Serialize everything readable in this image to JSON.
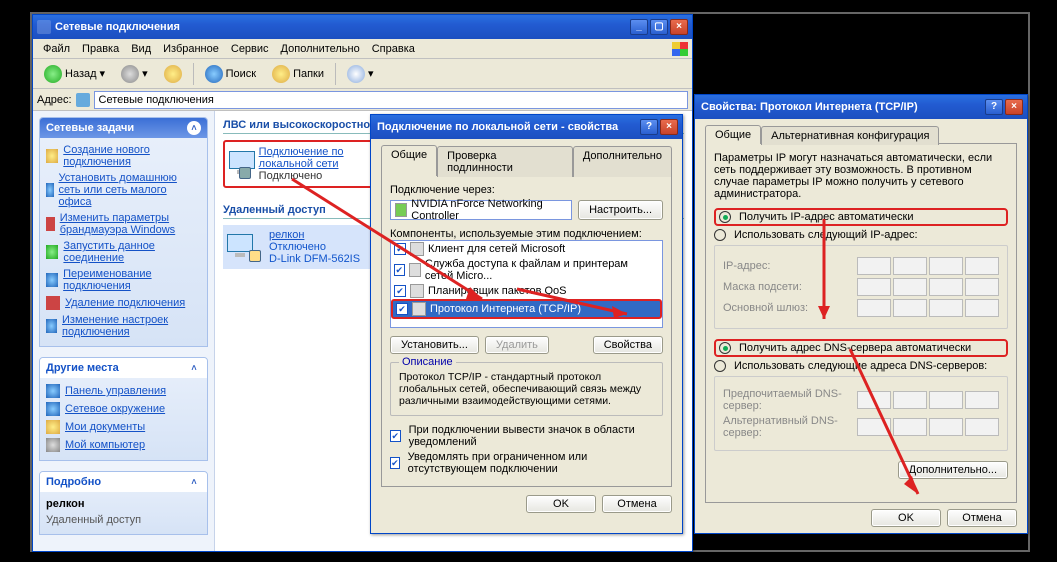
{
  "explorer": {
    "title": "Сетевые подключения",
    "menu": [
      "Файл",
      "Правка",
      "Вид",
      "Избранное",
      "Сервис",
      "Дополнительно",
      "Справка"
    ],
    "toolbar": {
      "back": "Назад",
      "search": "Поиск",
      "folders": "Папки"
    },
    "address_label": "Адрес:",
    "address_value": "Сетевые подключения",
    "pane_tasks": {
      "title": "Сетевые задачи",
      "items": [
        "Создание нового подключения",
        "Установить домашнюю сеть или сеть малого офиса",
        "Изменить параметры брандмауэра Windows",
        "Запустить данное соединение",
        "Переименование подключения",
        "Удаление подключения",
        "Изменение настроек подключения"
      ]
    },
    "pane_places": {
      "title": "Другие места",
      "items": [
        "Панель управления",
        "Сетевое окружение",
        "Мои документы",
        "Мой компьютер"
      ]
    },
    "pane_details": {
      "title": "Подробно",
      "name": "релкон",
      "type": "Удаленный доступ"
    },
    "groups": {
      "lan": "ЛВС или высокоскоростной Интернет",
      "dialup": "Удаленный доступ"
    },
    "lan_item": {
      "name": "Подключение по локальной сети",
      "status": "Подключено"
    },
    "dial_item": {
      "name": "релкон",
      "status": "Отключено",
      "device": "D-Link DFM-562IS"
    }
  },
  "props1": {
    "title": "Подключение по локальной сети - свойства",
    "tabs": [
      "Общие",
      "Проверка подлинности",
      "Дополнительно"
    ],
    "connect_via": "Подключение через:",
    "adapter": "NVIDIA nForce Networking Controller",
    "configure": "Настроить...",
    "components": "Компоненты, используемые этим подключением:",
    "list": [
      "Клиент для сетей Microsoft",
      "Служба доступа к файлам и принтерам сетей Micro...",
      "Планировщик пакетов QoS",
      "Протокол Интернета (TCP/IP)"
    ],
    "install": "Установить...",
    "remove": "Удалить",
    "properties": "Свойства",
    "desc_title": "Описание",
    "desc": "Протокол TCP/IP - стандартный протокол глобальных сетей, обеспечивающий связь между различными взаимодействующими сетями.",
    "tray": "При подключении вывести значок в области уведомлений",
    "notify": "Уведомлять при ограниченном или отсутствующем подключении",
    "ok": "OK",
    "cancel": "Отмена"
  },
  "props2": {
    "title": "Свойства: Протокол Интернета (TCP/IP)",
    "tabs": [
      "Общие",
      "Альтернативная конфигурация"
    ],
    "intro": "Параметры IP могут назначаться автоматически, если сеть поддерживает эту возможность. В противном случае параметры IP можно получить у сетевого администратора.",
    "ip_auto": "Получить IP-адрес автоматически",
    "ip_manual": "Использовать следующий IP-адрес:",
    "ip": "IP-адрес:",
    "mask": "Маска подсети:",
    "gw": "Основной шлюз:",
    "dns_auto": "Получить адрес DNS-сервера автоматически",
    "dns_manual": "Использовать следующие адреса DNS-серверов:",
    "dns1": "Предпочитаемый DNS-сервер:",
    "dns2": "Альтернативный DNS-сервер:",
    "advanced": "Дополнительно...",
    "ok": "OK",
    "cancel": "Отмена"
  }
}
